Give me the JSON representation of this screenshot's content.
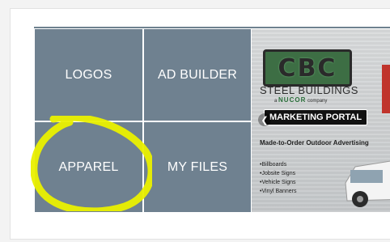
{
  "tiles": {
    "logos": "LOGOS",
    "ad_builder": "AD BUILDER",
    "apparel": "APPAREL",
    "my_files": "MY FILES"
  },
  "promo": {
    "brand": "CBC",
    "line1": "STEEL BUILDINGS",
    "nucor_name": "NUCOR",
    "nucor_suffix": "company",
    "portal": "MARKETING PORTAL",
    "tagline": "Made-to-Order Outdoor Advertising",
    "bullets": [
      "Billboards",
      "Jobsite Signs",
      "Vehicle Signs",
      "Vinyl Banners"
    ]
  },
  "colors": {
    "tile_bg": "#6f8190",
    "highlight": "#eaf000",
    "brand_green": "#3d6e44"
  }
}
